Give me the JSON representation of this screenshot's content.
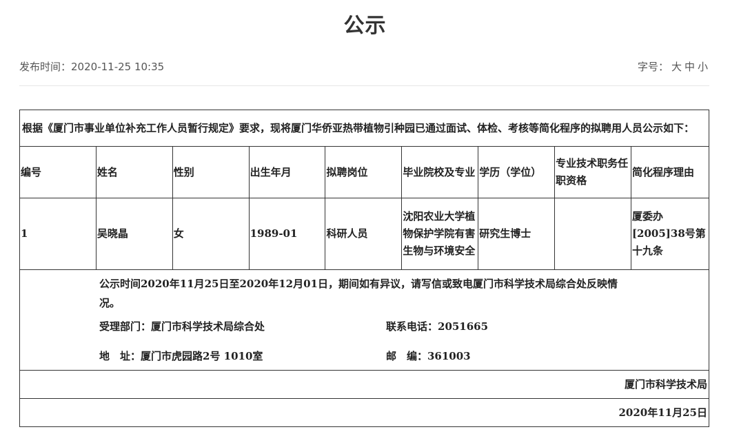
{
  "title": "公示",
  "meta": {
    "publish_label": "发布时间：",
    "publish_time": "2020-11-25 10:35",
    "font_label": "字号：",
    "font_large": "大",
    "font_medium": "中",
    "font_small": "小"
  },
  "notice": {
    "intro": "根据《厦门市事业单位补充工作人员暂行规定》要求，现将厦门华侨亚热带植物引种园已通过面试、体检、考核等简化程序的拟聘用人员公示如下：",
    "headers": [
      "编号",
      "姓名",
      "性别",
      "出生年月",
      "拟聘岗位",
      "毕业院校及专业",
      "学历（学位）",
      "专业技术职务任职资格",
      "简化程序理由"
    ],
    "rows": [
      [
        "1",
        "吴晓晶",
        "女",
        "1989-01",
        "科研人员",
        "沈阳农业大学植物保护学院有害生物与环境安全",
        "研究生博士",
        "",
        "厦委办[2005]38号第十九条"
      ]
    ],
    "period_text": "公示时间2020年11月25日至2020年12月01日，期间如有异议，请写信或致电厦门市科学技术局综合处反映情况。",
    "dept": "受理部门：厦门市科学技术局综合处",
    "phone": "联系电话：2051665",
    "address": "地　址：厦门市虎园路2号 1010室",
    "postcode": "邮　编：361003",
    "signer": "厦门市科学技术局",
    "date": "2020年11月25日"
  }
}
